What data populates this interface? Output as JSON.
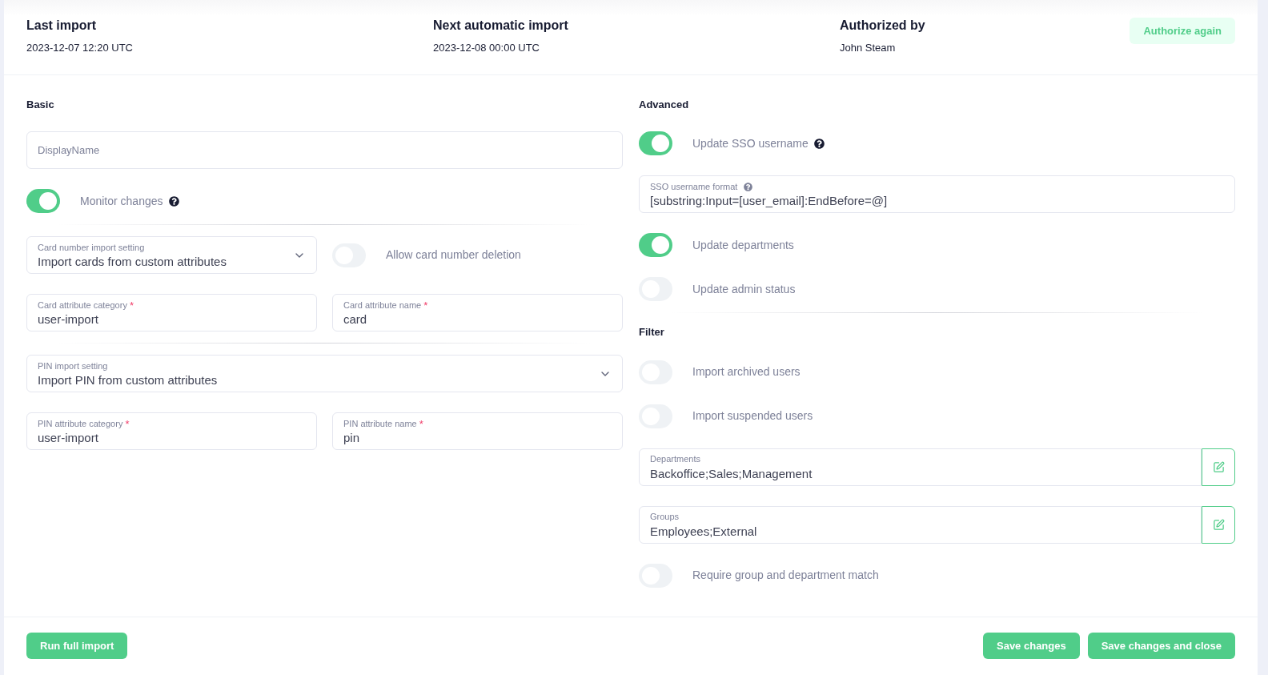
{
  "header": {
    "items": [
      {
        "label": "Last import",
        "value": "2023-12-07 12:20 UTC"
      },
      {
        "label": "Next automatic import",
        "value": "2023-12-08 00:00 UTC"
      },
      {
        "label": "Authorized by",
        "value": "John Steam"
      }
    ],
    "button": "Authorize again"
  },
  "basic": {
    "title": "Basic",
    "items": [
      {
        "kind": "input",
        "placeholder": "DisplayName"
      },
      {
        "kind": "toggle",
        "label": "Monitor changes",
        "on": true,
        "help": true
      },
      {
        "kind": "divider"
      },
      {
        "kind": "row",
        "items": [
          {
            "kind": "select",
            "label": "Card number import setting",
            "value": "Import cards from custom attributes"
          },
          {
            "kind": "toggle",
            "label": "Allow card number deletion",
            "on": false,
            "help": false
          }
        ]
      },
      {
        "kind": "row",
        "items": [
          {
            "kind": "field",
            "label": "Card attribute category",
            "value": "user-import",
            "required_mark": "*"
          },
          {
            "kind": "field",
            "label": "Card attribute name",
            "value": "card",
            "required_mark": "*"
          }
        ]
      },
      {
        "kind": "divider"
      },
      {
        "kind": "select",
        "label": "PIN import setting",
        "value": "Import PIN from custom attributes"
      },
      {
        "kind": "row",
        "items": [
          {
            "kind": "field",
            "label": "PIN attribute category",
            "value": "user-import",
            "required_mark": "*"
          },
          {
            "kind": "field",
            "label": "PIN attribute name",
            "value": "pin",
            "required_mark": "*"
          }
        ]
      }
    ]
  },
  "advanced": {
    "title": "Advanced",
    "items": [
      {
        "kind": "toggle",
        "label": "Update SSO username",
        "on": true,
        "help": true
      },
      {
        "kind": "field",
        "label": "SSO username format",
        "value": "[substring:Input=[user_email]:EndBefore=@]",
        "help": true
      },
      {
        "kind": "toggle",
        "label": "Update departments",
        "on": true,
        "help": false
      },
      {
        "kind": "toggle",
        "label": "Update admin status",
        "on": false,
        "help": false
      },
      {
        "kind": "divider"
      },
      {
        "kind": "heading",
        "text": "Filter"
      },
      {
        "kind": "toggle",
        "label": "Import archived users",
        "on": false,
        "help": false
      },
      {
        "kind": "toggle",
        "label": "Import suspended users",
        "on": false,
        "help": false
      },
      {
        "kind": "field",
        "label": "Departments",
        "value": "Backoffice;Sales;Management",
        "editable": true
      },
      {
        "kind": "field",
        "label": "Groups",
        "value": "Employees;External",
        "editable": true
      },
      {
        "kind": "toggle",
        "label": "Require group and department match",
        "on": false,
        "help": false
      }
    ]
  },
  "footer": {
    "left_button": "Run full import",
    "right_buttons": [
      "Save changes",
      "Save changes and close"
    ]
  }
}
